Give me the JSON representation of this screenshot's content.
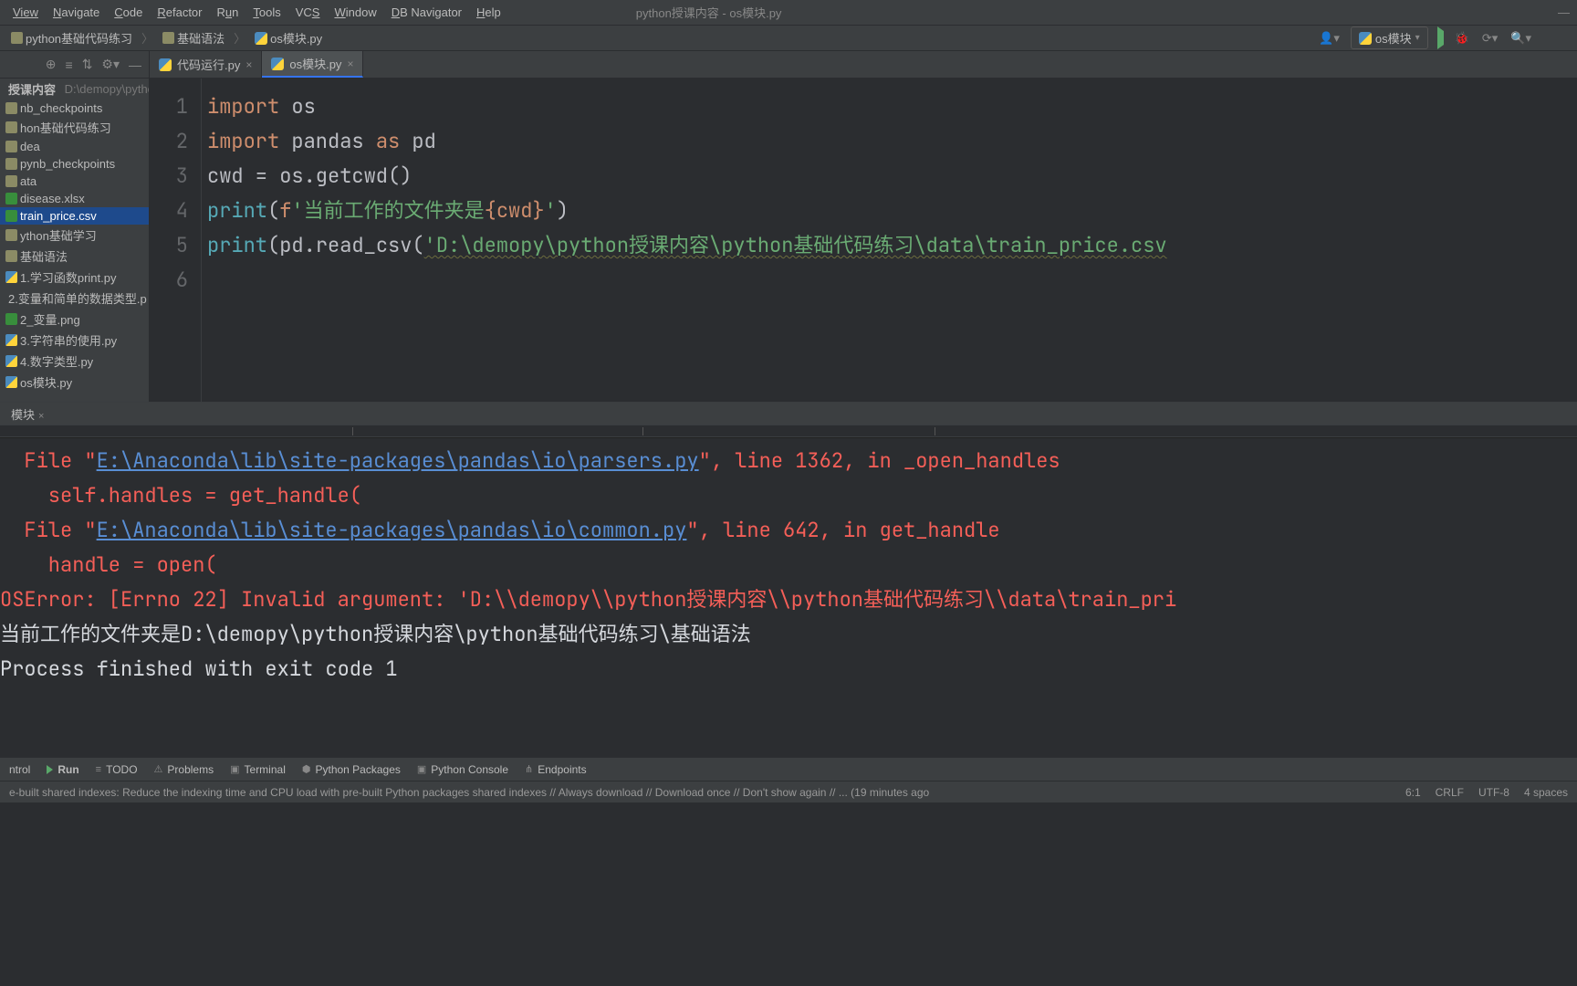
{
  "window_title": "python授课内容 - os模块.py",
  "menu": [
    "View",
    "Navigate",
    "Code",
    "Refactor",
    "Run",
    "Tools",
    "VCS",
    "Window",
    "DB Navigator",
    "Help"
  ],
  "menu_underline": [
    0,
    0,
    0,
    0,
    0,
    0,
    2,
    0,
    null,
    0
  ],
  "breadcrumb": [
    "python基础代码练习",
    "基础语法",
    "os模块.py"
  ],
  "run_config_label": "os模块",
  "project_tree": {
    "root_label": "授课内容",
    "root_path": "D:\\demopy\\pytho",
    "items": [
      {
        "label": "nb_checkpoints",
        "icon": "fld",
        "sel": false
      },
      {
        "label": "hon基础代码练习",
        "icon": "fld",
        "sel": false
      },
      {
        "label": "dea",
        "icon": "fld",
        "sel": false
      },
      {
        "label": "pynb_checkpoints",
        "icon": "fld",
        "sel": false
      },
      {
        "label": "ata",
        "icon": "fld",
        "sel": false
      },
      {
        "label": "disease.xlsx",
        "icon": "csv",
        "sel": false
      },
      {
        "label": "train_price.csv",
        "icon": "csv",
        "sel": true
      },
      {
        "label": "ython基础学习",
        "icon": "fld",
        "sel": false
      },
      {
        "label": "基础语法",
        "icon": "fld",
        "sel": false
      },
      {
        "label": "1.学习函数print.py",
        "icon": "py",
        "sel": false
      },
      {
        "label": "2.变量和简单的数据类型.p",
        "icon": "py",
        "sel": false
      },
      {
        "label": "2_变量.png",
        "icon": "csv",
        "sel": false
      },
      {
        "label": "3.字符串的使用.py",
        "icon": "py",
        "sel": false
      },
      {
        "label": "4.数字类型.py",
        "icon": "py",
        "sel": false
      },
      {
        "label": "os模块.py",
        "icon": "py",
        "sel": false
      }
    ]
  },
  "tabs": [
    {
      "label": "代码运行.py",
      "active": false
    },
    {
      "label": "os模块.py",
      "active": true
    }
  ],
  "code_lines": [
    "1",
    "2",
    "3",
    "4",
    "5",
    "6"
  ],
  "code": {
    "l1_kw": "import",
    "l1_pk": "os",
    "l2_kw": "import",
    "l2_pk": "pandas",
    "l2_as": "as",
    "l2_al": "pd",
    "l3": "cwd = os.getcwd()",
    "l4_print": "print",
    "l4_f": "f",
    "l4_s1": "'当前工作的文件夹是",
    "l4_br": "{cwd}",
    "l4_s2": "'",
    "l5_print": "print",
    "l5_call": "(pd.read_csv(",
    "l5_str": "'D:\\demopy\\python授课内容\\python基础代码练习\\data\\train_price.csv"
  },
  "console": {
    "line1_a": "  File \"",
    "line1_link": "E:\\Anaconda\\lib\\site-packages\\pandas\\io\\parsers.py",
    "line1_b": "\", line 1362, in _open_handles",
    "line2": "    self.handles = get_handle(",
    "line3_a": "  File \"",
    "line3_link": "E:\\Anaconda\\lib\\site-packages\\pandas\\io\\common.py",
    "line3_b": "\", line 642, in get_handle",
    "line4": "    handle = open(",
    "line5": "OSError: [Errno 22] Invalid argument: 'D:\\\\demopy\\\\python授课内容\\\\python基础代码练习\\\\data\\train_pri",
    "line6": "当前工作的文件夹是D:\\demopy\\python授课内容\\python基础代码练习\\基础语法",
    "line7": "",
    "line8": "Process finished with exit code 1"
  },
  "panel_tab": "模块",
  "bottom_tools": [
    "ntrol",
    "Run",
    "TODO",
    "Problems",
    "Terminal",
    "Python Packages",
    "Python Console",
    "Endpoints"
  ],
  "statusbar": {
    "msg": "e-built shared indexes: Reduce the indexing time and CPU load with pre-built Python packages shared indexes // Always download // Download once // Don't show again // ... (19 minutes ago",
    "pos": "6:1",
    "eol": "CRLF",
    "enc": "UTF-8",
    "indent": "4 spaces"
  },
  "colors": {
    "accent": "#3574f0",
    "green": "#59a869",
    "bg": "#2b2d30"
  }
}
